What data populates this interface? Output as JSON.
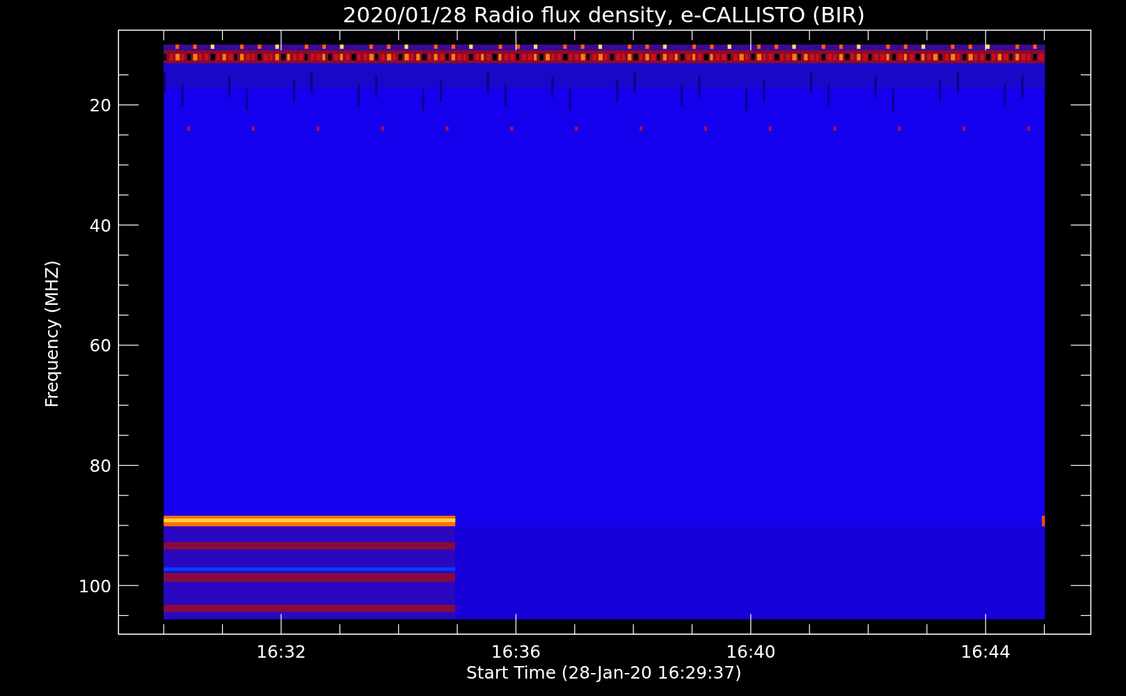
{
  "title": "2020/01/28  Radio flux density, e-CALLISTO (BIR)",
  "ylabel": "Frequency (MHZ)",
  "xlabel": "Start Time (28-Jan-20 16:29:37)",
  "yticks": [
    "20",
    "40",
    "60",
    "80",
    "100"
  ],
  "xticks": [
    "16:32",
    "16:36",
    "16:40",
    "16:44"
  ]
}
